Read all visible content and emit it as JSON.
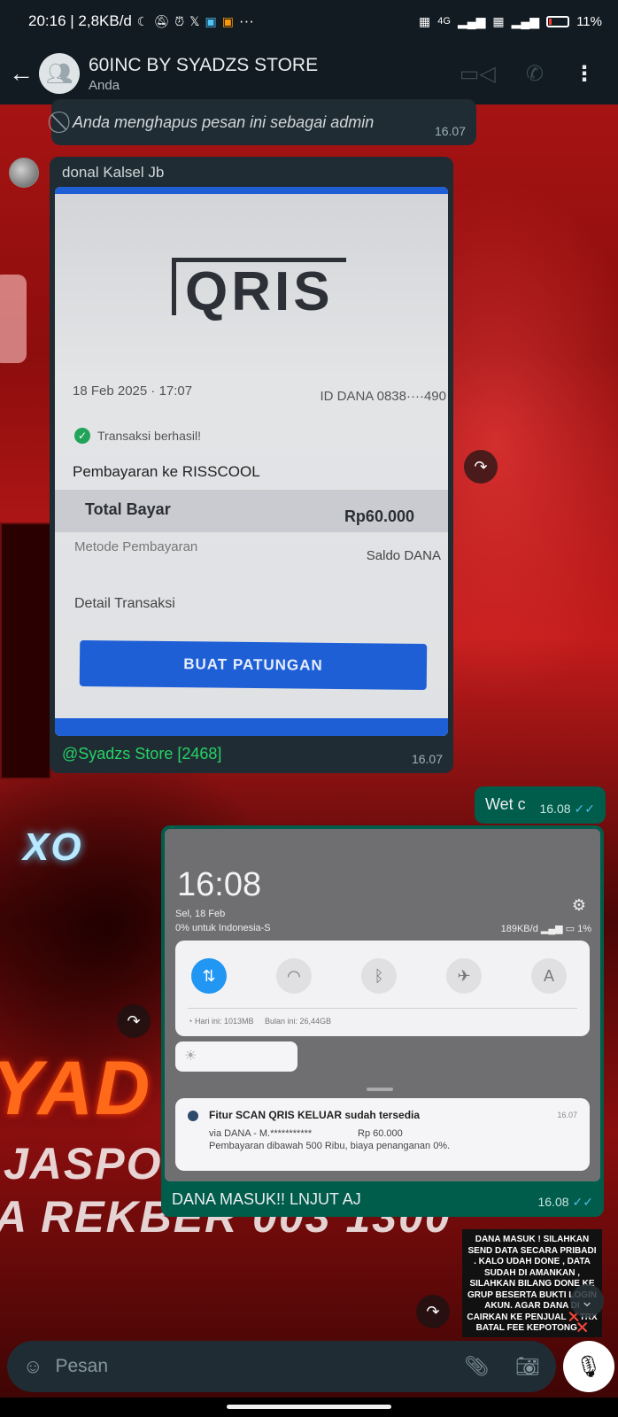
{
  "status_bar": {
    "time_speed": "20:16 | 2,8KB/d",
    "icons": [
      "moon-icon",
      "mute-icon",
      "alarm-icon",
      "x-icon",
      "app-icon",
      "app-icon",
      "more-icon"
    ],
    "dots": "···",
    "net_left": "4G",
    "battery": "11%"
  },
  "header": {
    "title": "60INC BY SYADZS STORE",
    "subtitle": "Anda"
  },
  "messages": {
    "deleted": {
      "text": "Anda menghapus pesan ini sebagai admin",
      "time": "16.07"
    },
    "qris": {
      "sender": "donal Kalsel Jb",
      "image": {
        "logo": "QRIS",
        "date": "18 Feb 2025 · 17:07",
        "id": "ID DANA 0838····490",
        "status": "Transaksi berhasil!",
        "paid_to": "Pembayaran ke RISSCOOL",
        "total_label": "Total Bayar",
        "total_value": "Rp60.000",
        "method_label": "Metode Pembayaran",
        "method_value": "Saldo DANA",
        "detail": "Detail Transaksi",
        "button": "BUAT PATUNGAN"
      },
      "mention": "@Syadzs Store [2468]",
      "time": "16.07"
    },
    "wetc": {
      "text": "Wet c",
      "time": "16.08"
    },
    "screenshot": {
      "image": {
        "time": "16:08",
        "date": "Sel, 18 Feb",
        "subline": "0% untuk Indonesia-S",
        "speed": "189KB/d",
        "battery": "1%",
        "usage_today": "Hari ini: 1013MB",
        "usage_month": "Bulan ini: 26,44GB",
        "toggles": [
          "⇅",
          "wifi",
          "bt",
          "✈",
          "A"
        ],
        "notif_title": "Fitur SCAN QRIS KELUAR sudah tersedia",
        "notif_time": "16.07",
        "notif_via": "via DANA - M.***********",
        "notif_amount": "Rp 60.000",
        "notif_body": "Pembayaran dibawah 500 Ribu, biaya penanganan 0%."
      },
      "caption": "DANA MASUK!! LNJUT AJ",
      "time": "16.08"
    }
  },
  "sticker_text": "DANA MASUK ! SILAHKAN SEND DATA SECARA PRIBADI . KALO UDAH DONE , DATA SUDAH DI AMANKAN , SILAHKAN BILANG DONE KE GRUP BESERTA BUKTI LOGIN AKUN. AGAR DANA DI CAIRKAN KE PENJUAL ❌TRX BATAL FEE KEPOTONG❌",
  "wallpaper": {
    "text_big": "YAD",
    "text_line1": "JASPO",
    "text_line2": "A REKBER 003 1300",
    "text_xo": "XO"
  },
  "input": {
    "placeholder": "Pesan"
  },
  "colors": {
    "header_bg": "#111b21",
    "incoming": "#202c33",
    "outgoing": "#005c4b",
    "accent_green": "#25d366",
    "tick_blue": "#53bdeb"
  }
}
